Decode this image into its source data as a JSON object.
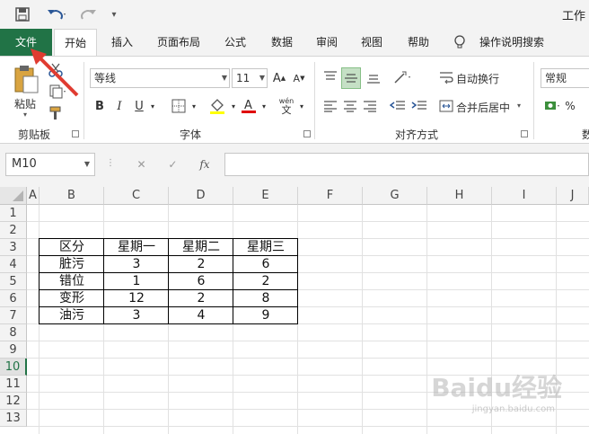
{
  "window": {
    "title": "工作"
  },
  "quick_access": {
    "save_icon": "save-icon",
    "undo_icon": "undo-icon",
    "redo_icon": "redo-icon",
    "customize_icon": "customize-icon"
  },
  "tabs": [
    {
      "label": "文件"
    },
    {
      "label": "开始"
    },
    {
      "label": "插入"
    },
    {
      "label": "页面布局"
    },
    {
      "label": "公式"
    },
    {
      "label": "数据"
    },
    {
      "label": "审阅"
    },
    {
      "label": "视图"
    },
    {
      "label": "帮助"
    },
    {
      "label": "操作说明搜索"
    }
  ],
  "ribbon": {
    "clipboard": {
      "paste_label": "粘贴",
      "group_label": "剪贴板"
    },
    "font": {
      "font_name": "等线",
      "font_size": "11",
      "group_label": "字体",
      "bold": "B",
      "italic": "I",
      "underline": "U",
      "wen_top": "wén",
      "wen_bottom": "文"
    },
    "alignment": {
      "wrap_label": "自动换行",
      "merge_label": "合并后居中",
      "group_label": "对齐方式"
    },
    "number": {
      "format": "常规",
      "group_label": "数",
      "percent": "%"
    }
  },
  "formula_bar": {
    "name_box": "M10",
    "fx_label": "fx",
    "formula_value": ""
  },
  "grid": {
    "columns": [
      "A",
      "B",
      "C",
      "D",
      "E",
      "F",
      "G",
      "H",
      "I",
      "J"
    ],
    "rows": [
      "1",
      "2",
      "3",
      "4",
      "5",
      "6",
      "7",
      "8",
      "9",
      "10",
      "11",
      "12",
      "13"
    ],
    "selected_row": "10",
    "table": {
      "header": [
        "区分",
        "星期一",
        "星期二",
        "星期三"
      ],
      "rows": [
        [
          "脏污",
          "3",
          "2",
          "6"
        ],
        [
          "错位",
          "1",
          "6",
          "2"
        ],
        [
          "变形",
          "12",
          "2",
          "8"
        ],
        [
          "油污",
          "3",
          "4",
          "9"
        ]
      ]
    }
  },
  "watermark": {
    "main": "Baidu经验",
    "sub": "jingyan.baidu.com"
  },
  "colors": {
    "accent": "#217346",
    "arrow": "#e03c31"
  }
}
